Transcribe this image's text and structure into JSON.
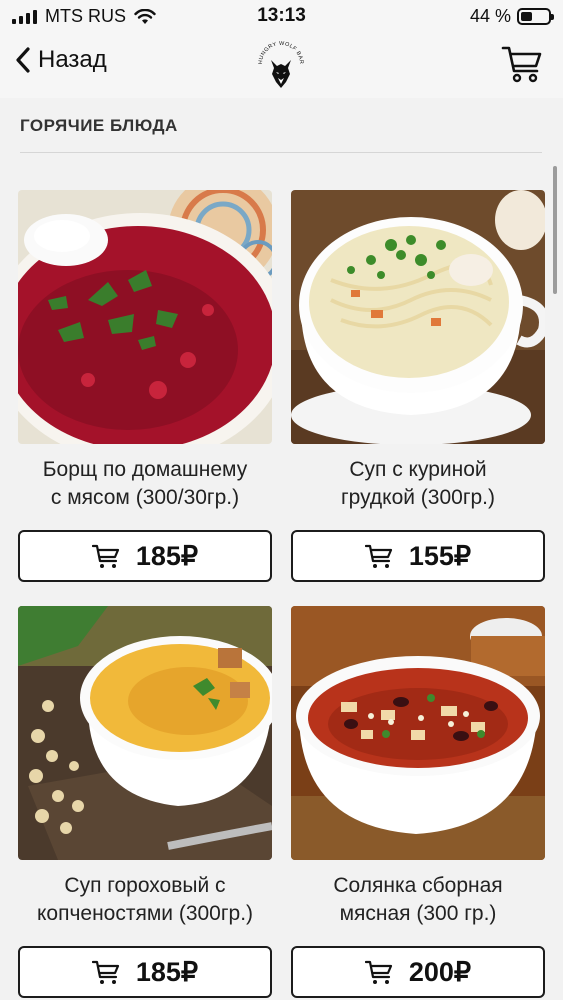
{
  "status": {
    "carrier": "MTS RUS",
    "time": "13:13",
    "battery_percent": "44 %",
    "battery_level": 0.44
  },
  "nav": {
    "back_label": "Назад",
    "logo_text": "HUNGRY WOLF BAR",
    "cart_icon": "shopping-cart-icon"
  },
  "section": {
    "title": "ГОРЯЧИЕ БЛЮДА"
  },
  "items": [
    {
      "name_line1": "Борщ по домашнему",
      "name_line2": "с мясом (300/30гр.)",
      "price": "185₽"
    },
    {
      "name_line1": "Суп с куриной",
      "name_line2": "грудкой (300гр.)",
      "price": "155₽"
    },
    {
      "name_line1": "Суп гороховый с",
      "name_line2": "копченостями (300гр.)",
      "price": "185₽"
    },
    {
      "name_line1": "Солянка сборная",
      "name_line2": "мясная (300 гр.)",
      "price": "200₽"
    }
  ]
}
